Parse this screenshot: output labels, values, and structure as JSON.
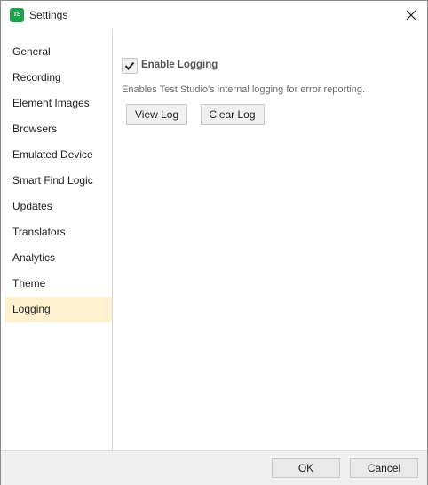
{
  "window": {
    "title": "Settings",
    "app_icon_text": "TS"
  },
  "sidebar": {
    "items": [
      {
        "label": "General"
      },
      {
        "label": "Recording"
      },
      {
        "label": "Element Images"
      },
      {
        "label": "Browsers"
      },
      {
        "label": "Emulated Device"
      },
      {
        "label": "Smart Find Logic"
      },
      {
        "label": "Updates"
      },
      {
        "label": "Translators"
      },
      {
        "label": "Analytics"
      },
      {
        "label": "Theme"
      },
      {
        "label": "Logging"
      }
    ],
    "active_index": 10
  },
  "logging": {
    "enable_label": "Enable Logging",
    "enabled": true,
    "description": "Enables Test Studio's internal logging for error reporting.",
    "view_log_label": "View Log",
    "clear_log_label": "Clear Log"
  },
  "footer": {
    "ok_label": "OK",
    "cancel_label": "Cancel"
  },
  "colors": {
    "active_item_bg": "#fdf1d0",
    "app_icon_bg": "#1aa34a"
  }
}
